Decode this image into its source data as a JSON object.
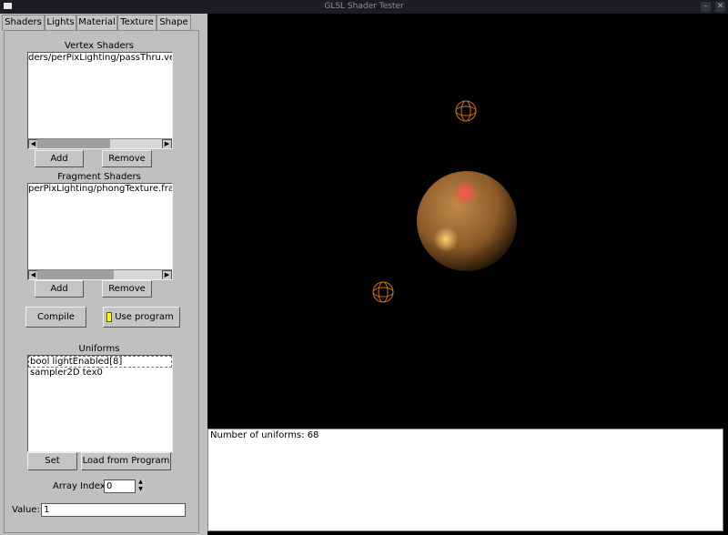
{
  "window": {
    "title": "GLSL Shader Tester"
  },
  "tabs": [
    {
      "label": "Shaders"
    },
    {
      "label": "Lights"
    },
    {
      "label": "Material"
    },
    {
      "label": "Texture"
    },
    {
      "label": "Shape"
    }
  ],
  "vertex": {
    "label": "Vertex Shaders",
    "items": [
      "ders/perPixLighting/passThru.vert"
    ],
    "add": "Add",
    "remove": "Remove"
  },
  "fragment": {
    "label": "Fragment Shaders",
    "items": [
      "perPixLighting/phongTexture.frag"
    ],
    "add": "Add",
    "remove": "Remove"
  },
  "compile": "Compile",
  "use_program": {
    "label": "Use program",
    "checked": true,
    "color": "#ffff00"
  },
  "uniforms": {
    "label": "Uniforms",
    "items": [
      "bool lightEnabled[8]",
      "sampler2D tex0"
    ],
    "set": "Set",
    "load": "Load from Program"
  },
  "array_index": {
    "label": "Array Index",
    "value": "0"
  },
  "value": {
    "label": "Value:",
    "value": "1"
  },
  "output": {
    "text": "Number of uniforms: 68"
  }
}
